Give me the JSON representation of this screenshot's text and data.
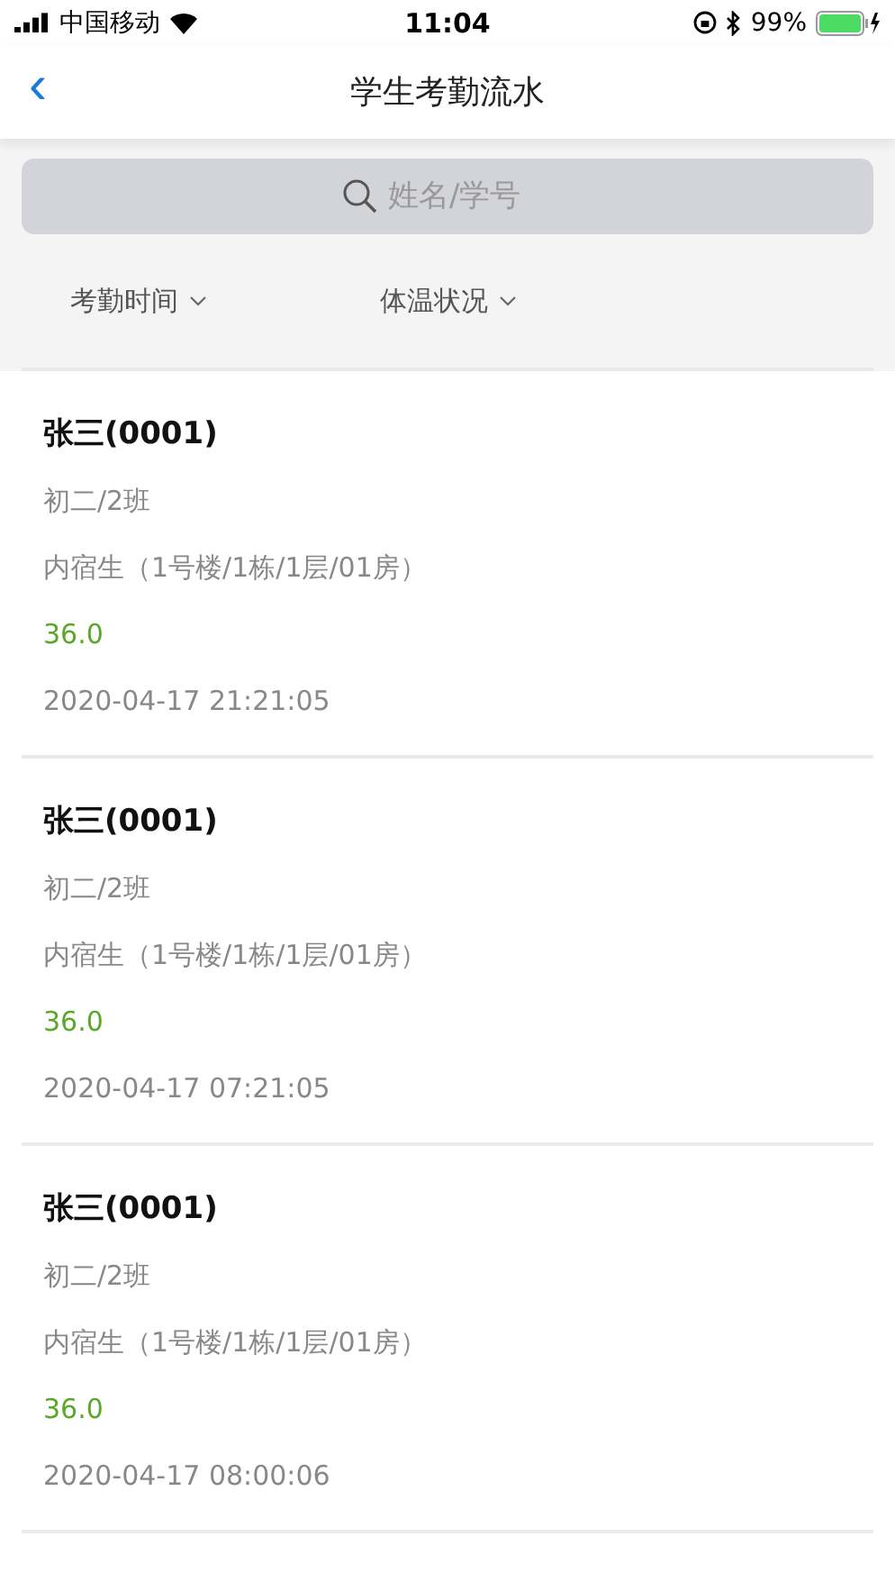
{
  "status_bar": {
    "carrier": "中国移动",
    "time": "11:04",
    "battery": "99%"
  },
  "nav": {
    "back": "‹",
    "title": "学生考勤流水"
  },
  "search": {
    "placeholder": "姓名/学号"
  },
  "filters": [
    {
      "label": "考勤时间"
    },
    {
      "label": "体温状况"
    }
  ],
  "records": [
    {
      "name": "张三(0001)",
      "class": "初二/2班",
      "dorm": "内宿生（1号楼/1栋/1层/01房）",
      "temperature": "36.0",
      "color": "#5aa72a",
      "time": "2020-04-17 21:21:05"
    },
    {
      "name": "张三(0001)",
      "class": "初二/2班",
      "dorm": "内宿生（1号楼/1栋/1层/01房）",
      "temperature": "36.0",
      "color": "#5aa72a",
      "time": "2020-04-17 07:21:05"
    },
    {
      "name": "张三(0001)",
      "class": "初二/2班",
      "dorm": "内宿生（1号楼/1栋/1层/01房）",
      "temperature": "36.0",
      "color": "#5aa72a",
      "time": "2020-04-17 08:00:06"
    }
  ]
}
